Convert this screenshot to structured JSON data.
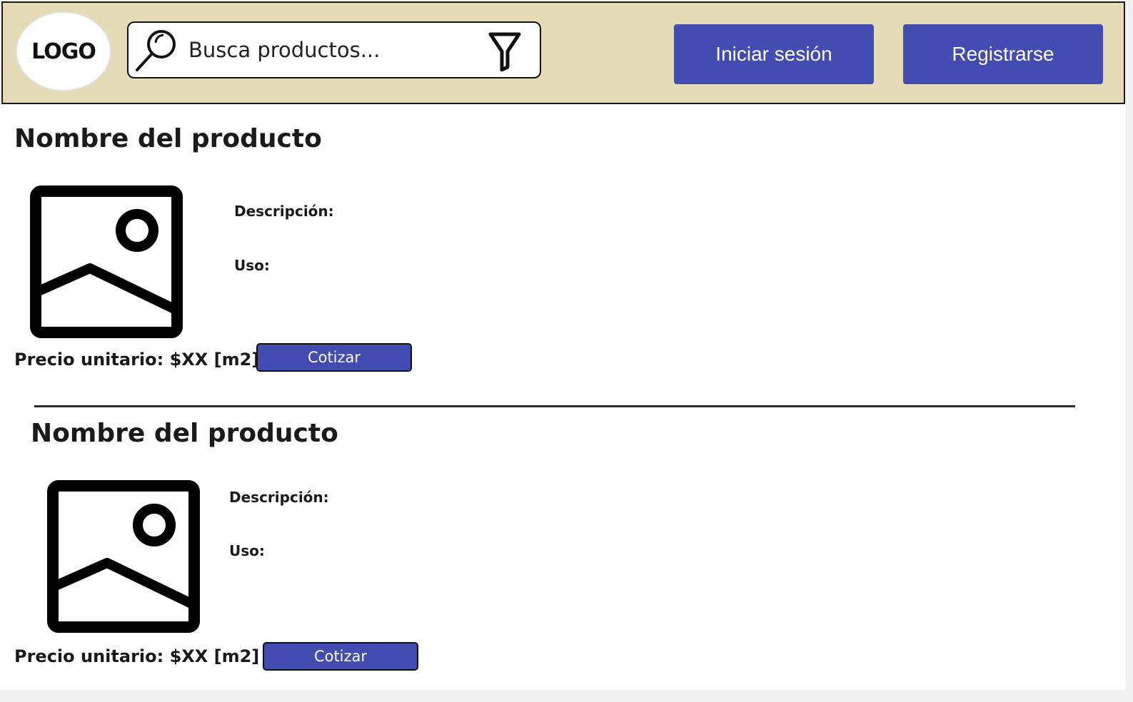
{
  "header": {
    "logo_text": "LOGO",
    "search_placeholder": "Busca productos...",
    "login_label": "Iniciar sesión",
    "register_label": "Registrarse"
  },
  "products": [
    {
      "name": "Nombre del producto",
      "description_label": "Descripción:",
      "use_label": "Uso:",
      "price_text": "Precio unitario: $XX [m2]",
      "quote_label": "Cotizar"
    },
    {
      "name": "Nombre del producto",
      "description_label": "Descripción:",
      "use_label": "Uso:",
      "price_text": "Precio unitario: $XX [m2]",
      "quote_label": "Cotizar"
    }
  ],
  "colors": {
    "header_bg": "#e6dbb7",
    "button_bg": "#434cb0"
  }
}
